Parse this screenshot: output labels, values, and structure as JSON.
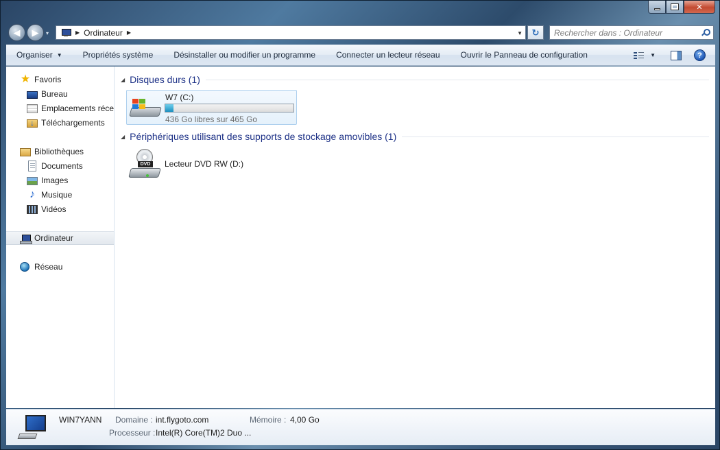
{
  "window": {
    "minimize_glyph": "minimize",
    "maximize_glyph": "maximize",
    "close_glyph": "✕"
  },
  "nav": {
    "back_glyph": "◀",
    "forward_glyph": "▶",
    "history_glyph": "▾"
  },
  "address": {
    "location": "Ordinateur",
    "separator": "▶",
    "dropdown_glyph": "▼"
  },
  "refresh_glyph": "↻",
  "search": {
    "placeholder": "Rechercher dans : Ordinateur",
    "value": ""
  },
  "toolbar": {
    "organize": "Organiser",
    "caret": "▼",
    "system_properties": "Propriétés système",
    "uninstall": "Désinstaller ou modifier un programme",
    "map_drive": "Connecter un lecteur réseau",
    "control_panel": "Ouvrir le Panneau de configuration",
    "help_glyph": "?"
  },
  "sidebar": {
    "favorites": "Favoris",
    "favorites_items": [
      "Bureau",
      "Emplacements récents",
      "Téléchargements"
    ],
    "libraries": "Bibliothèques",
    "libraries_items": [
      "Documents",
      "Images",
      "Musique",
      "Vidéos"
    ],
    "computer": "Ordinateur",
    "network": "Réseau"
  },
  "groups": {
    "hard_drives": "Disques durs (1)",
    "removable": "Périphériques utilisant des supports de stockage amovibles (1)",
    "collapse_glyph": "◢"
  },
  "drives": {
    "c": {
      "name": "W7 (C:)",
      "free_text": "436 Go libres sur 465 Go",
      "used_fraction": 0.0624
    },
    "d": {
      "name": "Lecteur DVD RW (D:)",
      "badge": "DVD"
    }
  },
  "details": {
    "computer_name": "WIN7YANN",
    "domain_label": "Domaine :",
    "domain_value": "int.flygoto.com",
    "memory_label": "Mémoire :",
    "memory_value": "4,00 Go",
    "processor_label": "Processeur :",
    "processor_value": "Intel(R) Core(TM)2 Duo ..."
  },
  "colors": {
    "group_title": "#1e3287",
    "bar_fill": "#1c90c0",
    "secondary_text": "#6d6d6d"
  }
}
